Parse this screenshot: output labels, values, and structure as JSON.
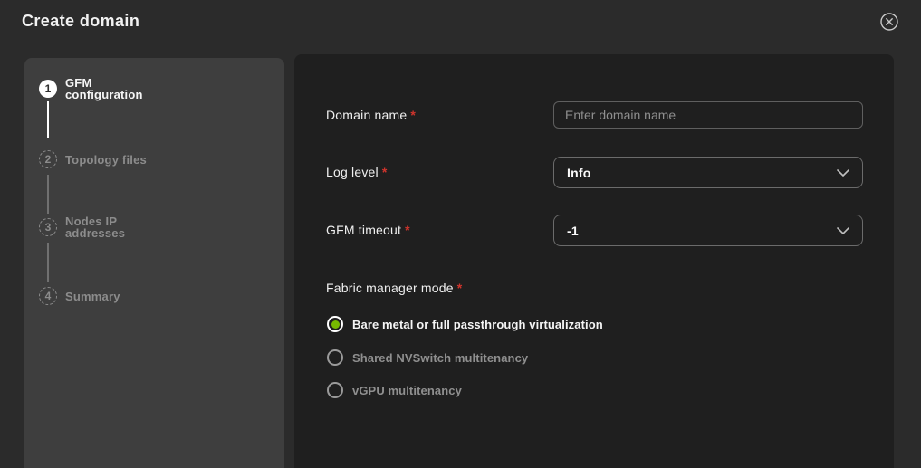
{
  "modal": {
    "title": "Create domain"
  },
  "icons": {
    "close": "circle-x-icon",
    "select_chevron": "chevron-down-icon"
  },
  "stepper": {
    "steps": [
      {
        "number": "1",
        "label": "GFM\nconfiguration",
        "state": "active"
      },
      {
        "number": "2",
        "label": "Topology files",
        "state": "upcoming"
      },
      {
        "number": "3",
        "label": "Nodes IP\naddresses",
        "state": "upcoming"
      },
      {
        "number": "4",
        "label": "Summary",
        "state": "upcoming"
      }
    ]
  },
  "form": {
    "required_marker": "*",
    "fields": {
      "domain_name": {
        "label": "Domain name",
        "required": true,
        "placeholder": "Enter domain name",
        "value": ""
      },
      "log_level": {
        "label": "Log level",
        "required": true,
        "value": "Info"
      },
      "gfm_timeout": {
        "label": "GFM timeout",
        "required": true,
        "value": "-1"
      },
      "fabric_manager_mode": {
        "label": "Fabric manager mode",
        "required": true,
        "options": [
          {
            "label": "Bare metal or full passthrough virtualization",
            "selected": true
          },
          {
            "label": "Shared NVSwitch multitenancy",
            "selected": false
          },
          {
            "label": "vGPU multitenancy",
            "selected": false
          }
        ]
      }
    }
  },
  "colors": {
    "page_background": "#2b2b2b",
    "sidebar_background": "#3e3e3e",
    "panel_background": "#1f1f1f",
    "accent_green": "#76b900",
    "required_red": "#d0342c",
    "text_primary": "#f2f2f2",
    "text_muted": "#8c8c8c"
  }
}
